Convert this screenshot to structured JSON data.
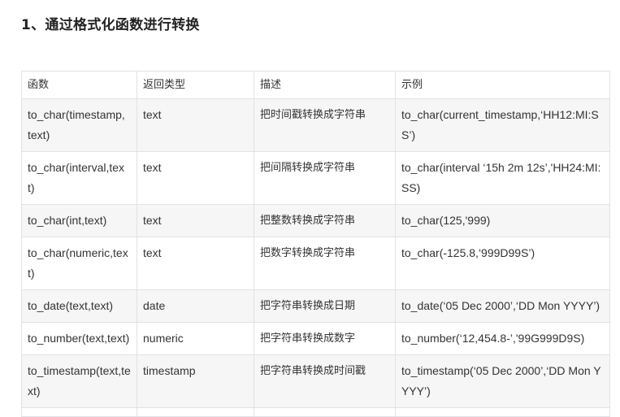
{
  "heading": "1、通过格式化函数进行转换",
  "table": {
    "headers": [
      "函数",
      "返回类型",
      "描述",
      "示例"
    ],
    "rows": [
      [
        "to_char(timestamp, text)",
        "text",
        "把时间戳转换成字符串",
        "to_char(current_timestamp,‘HH12:MI:SS’)"
      ],
      [
        "to_char(interval,text)",
        "text",
        "把间隔转换成字符串",
        "to_char(interval ‘15h 2m 12s’,'HH24:MI:SS)"
      ],
      [
        "to_char(int,text)",
        "text",
        "把整数转换成字符串",
        "to_char(125,'999)"
      ],
      [
        "to_char(numeric,text)",
        "text",
        "把数字转换成字符串",
        "to_char(-125.8,‘999D99S’)"
      ],
      [
        "to_date(text,text)",
        "date",
        "把字符串转换成日期",
        "to_date(‘05 Dec 2000’,‘DD Mon YYYY’)"
      ],
      [
        "to_number(text,text)",
        "numeric",
        "把字符串转换成数字",
        "to_number(‘12,454.8-’,'99G999D9S)"
      ],
      [
        "to_timestamp(text,text)",
        "timestamp",
        "把字符串转换成时间戳",
        "to_timestamp(‘05 Dec 2000’,‘DD Mon YYYY’)"
      ]
    ]
  }
}
